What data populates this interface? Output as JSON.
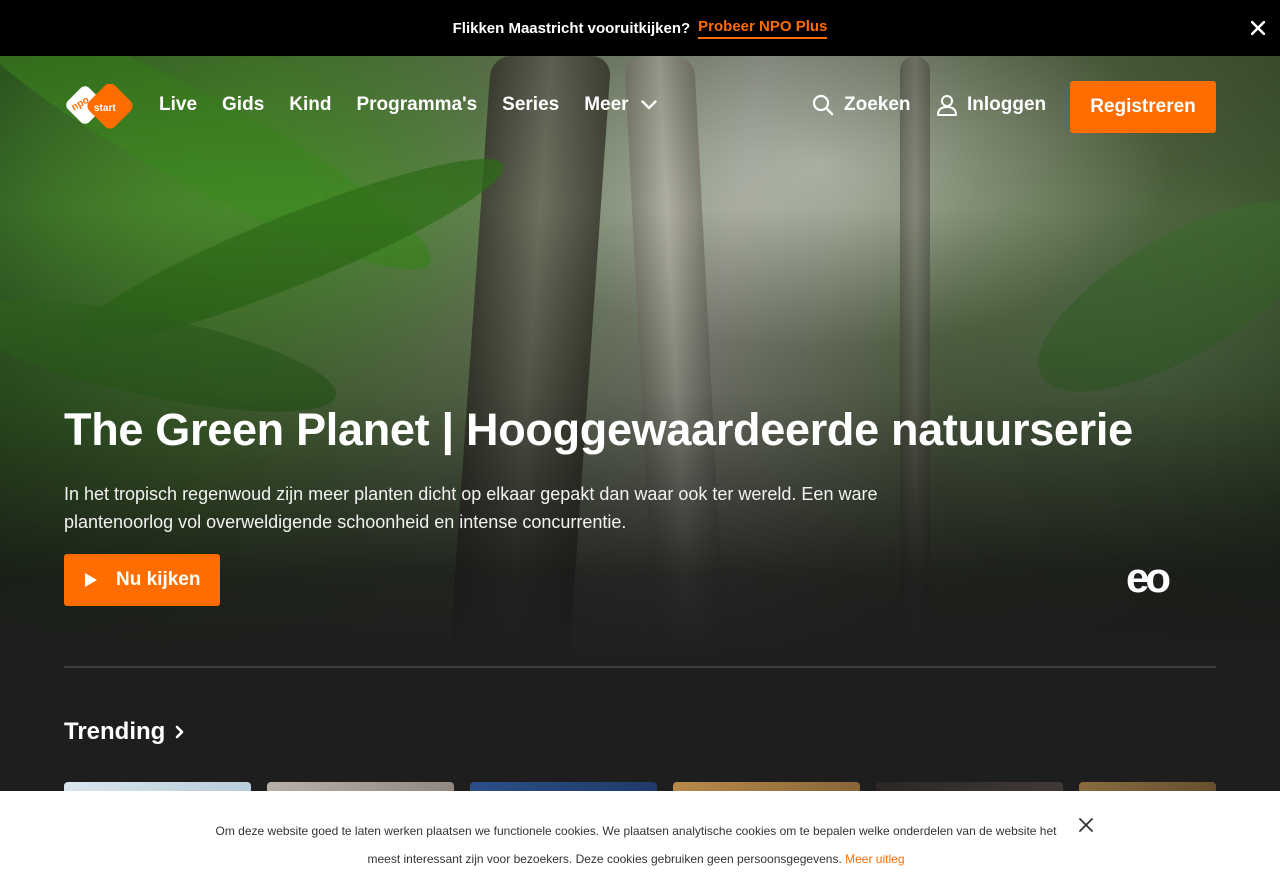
{
  "promo": {
    "text": "Flikken Maastricht vooruitkijken?",
    "link": "Probeer NPO Plus"
  },
  "header": {
    "logo_text_top": "npo",
    "logo_text_bottom": "start",
    "nav": [
      "Live",
      "Gids",
      "Kind",
      "Programma's",
      "Series"
    ],
    "meer": "Meer",
    "search": "Zoeken",
    "login": "Inloggen",
    "register": "Registreren"
  },
  "hero": {
    "title": "The Green Planet | Hooggewaardeerde natuurserie",
    "description": "In het tropisch regenwoud zijn meer planten dicht op elkaar gepakt dan waar ook ter wereld. Een ware plantenoorlog vol overweldigende schoonheid en intense concurrentie.",
    "watch": "Nu kijken",
    "broadcaster_logo": "eo"
  },
  "trending": {
    "title": "Trending"
  },
  "cookie": {
    "text": "Om deze website goed te laten werken plaatsen we functionele cookies. We plaatsen analytische cookies om te bepalen welke onderdelen van de website het meest interessant zijn voor bezoekers. Deze cookies gebruiken geen persoonsgegevens.",
    "more": "Meer uitleg"
  },
  "colors": {
    "accent": "#ff6d00",
    "background": "#1e1e1e",
    "promo_bar": "#000000",
    "cookie_bar": "#ffffff"
  }
}
